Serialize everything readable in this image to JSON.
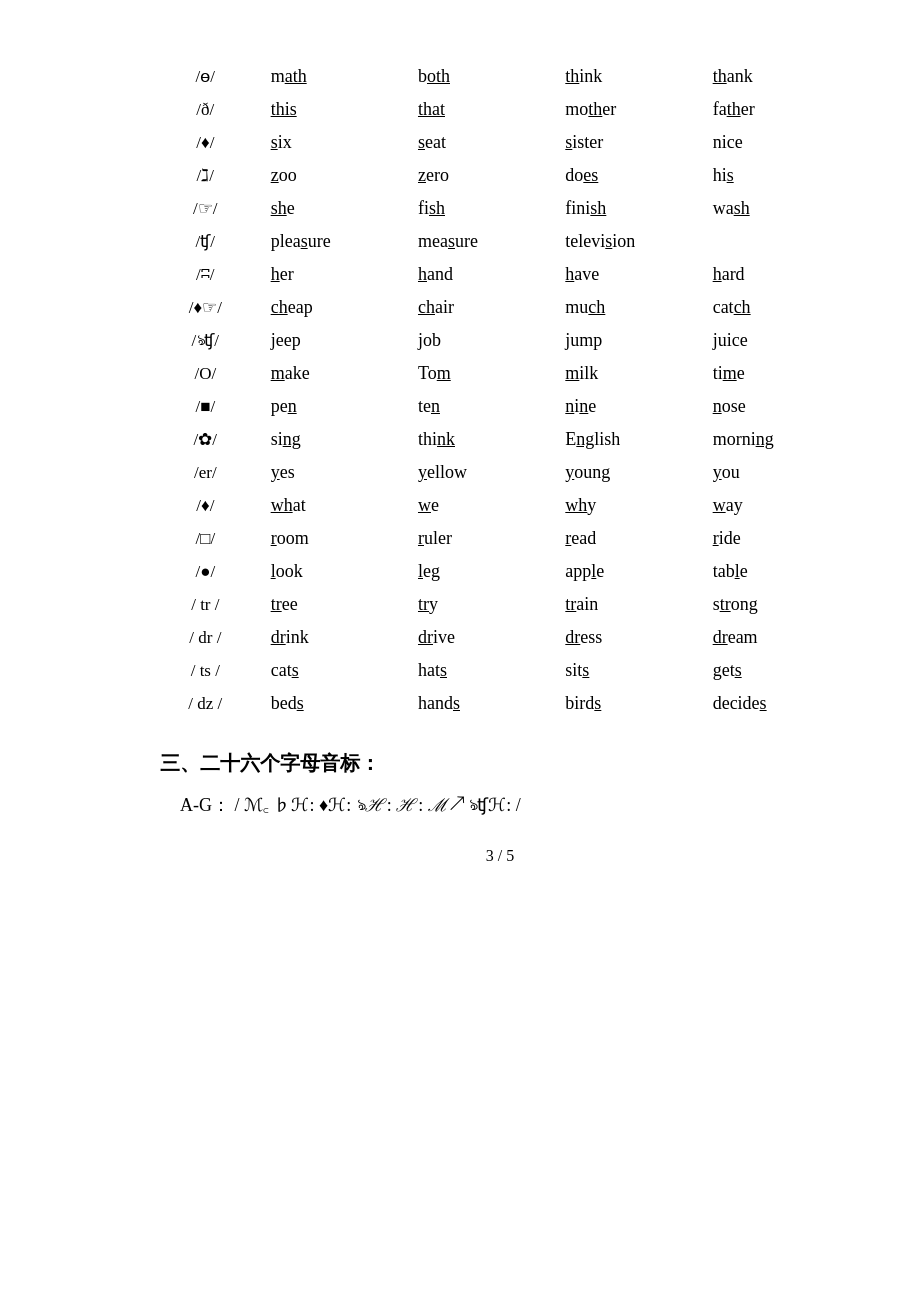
{
  "rows": [
    {
      "symbol": "/ɵ/",
      "words": [
        "m<u>ath</u>",
        "b<u>oth</u>",
        "<u>th</u>ink",
        "<u>th</u>ank"
      ]
    },
    {
      "symbol": "/ð/",
      "words": [
        "<u>this</u>",
        "<u>that</u>",
        "mo<u>th</u>er",
        "fa<u>th</u>er"
      ]
    },
    {
      "symbol": "/♦/",
      "words": [
        "<u>s</u>ix",
        "<u>s</u>eat",
        "<u>s</u>ister",
        "nice"
      ]
    },
    {
      "symbol": "/ℜ/",
      "words": [
        "<u>z</u>oo",
        "<u>z</u>ero",
        "do<u>es</u>",
        "hi<u>s</u>"
      ]
    },
    {
      "symbol": "/☞/",
      "words": [
        "<u>sh</u>e",
        "fi<u>sh</u>",
        "fini<u>sh</u>",
        "wa<u>sh</u>"
      ]
    },
    {
      "symbol": "/ʧ/",
      "words": [
        "plea<u>s</u>ure",
        "mea<u>s</u>ure",
        "televi<u>s</u>ion",
        ""
      ]
    },
    {
      "symbol": "/ʭ/",
      "words": [
        "<u>h</u>er",
        "<u>h</u>and",
        "<u>h</u>ave",
        "<u>h</u>ard"
      ]
    },
    {
      "symbol": "/♦☞/",
      "words": [
        "<u>ch</u>eap",
        "<u>ch</u>air",
        "mu<u>ch</u>",
        "cat<u>ch</u>"
      ]
    },
    {
      "symbol": "/ঌʧ/",
      "words": [
        "jeep",
        "job",
        "jump",
        "juice"
      ]
    },
    {
      "symbol": "/O/",
      "words": [
        "<u>m</u>ake",
        "To<u>m</u>",
        "<u>m</u>ilk",
        "ti<u>m</u>e"
      ]
    },
    {
      "symbol": "/■/",
      "words": [
        "pe<u>n</u>",
        "te<u>n</u>",
        "<u>n</u>i<u>n</u>e",
        "<u>n</u>ose"
      ]
    },
    {
      "symbol": "/✿/",
      "words": [
        "si<u>ng</u>",
        "thi<u>nk</u>",
        "E<u>ng</u>lish",
        "morni<u>ng</u>"
      ]
    },
    {
      "symbol": "/er/",
      "words": [
        "<u>y</u>es",
        "<u>y</u>ellow",
        "<u>y</u>oung",
        "<u>y</u>ou"
      ]
    },
    {
      "symbol": "/♦/",
      "words": [
        "<u>wh</u>at",
        "<u>w</u>e",
        "<u>wh</u>y",
        "<u>w</u>ay"
      ]
    },
    {
      "symbol": "/□/",
      "words": [
        "<u>r</u>oom",
        "<u>r</u>uler",
        "<u>r</u>ead",
        "<u>r</u>ide"
      ]
    },
    {
      "symbol": "/●/",
      "words": [
        "<u>l</u>ook",
        "<u>l</u>eg",
        "app<u>l</u>e",
        "tab<u>l</u>e"
      ]
    },
    {
      "symbol": "/ tr /",
      "words": [
        "<u>tr</u>ee",
        "<u>tr</u>y",
        "<u>tr</u>ain",
        "s<u>tr</u>ong"
      ]
    },
    {
      "symbol": "/ dr /",
      "words": [
        "<u>dr</u>ink",
        "<u>dr</u>ive",
        "<u>dr</u>ess",
        "<u>dr</u>eam"
      ]
    },
    {
      "symbol": "/ ts /",
      "words": [
        "cat<u>s</u>",
        "hat<u>s</u>",
        "sit<u>s</u>",
        "get<u>s</u>"
      ]
    },
    {
      "symbol": "/ dz /",
      "words": [
        "bed<u>s</u>",
        "hand<u>s</u>",
        "bird<u>s</u>",
        "decide<u>s</u>"
      ]
    }
  ],
  "section3_title": "三、二十六个字母音标：",
  "ag_label": "A-G：  /  ℳ꜀  ♭ℋ:  ♦ℋ:  ঌℋ:  ℋ:  ℳ↗  ঌʧℋ:  /",
  "page_num": "3 / 5"
}
